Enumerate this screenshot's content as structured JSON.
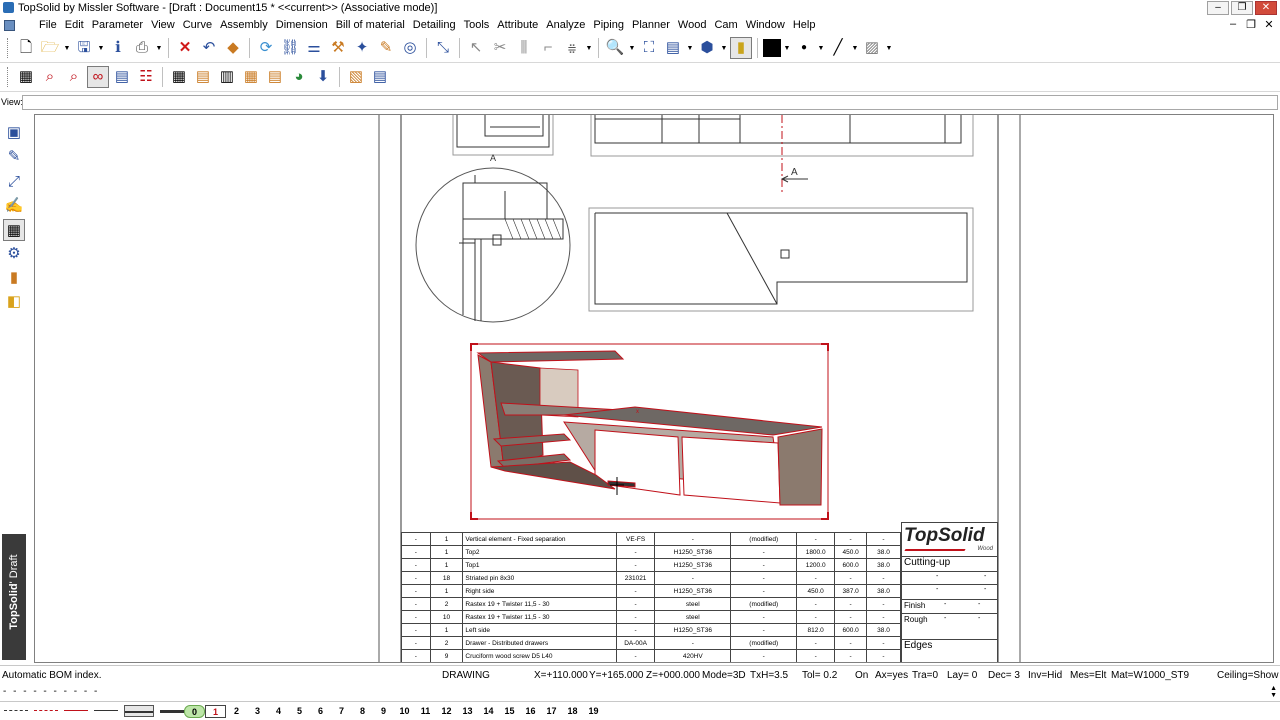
{
  "window": {
    "title": "TopSolid by Missler Software - [Draft : Document15 *  <<current>> (Associative mode)]",
    "buttons": {
      "minimize": "‒",
      "restore": "❐",
      "close": "✕"
    }
  },
  "menubar": {
    "items": [
      "File",
      "Edit",
      "Parameter",
      "View",
      "Curve",
      "Assembly",
      "Dimension",
      "Bill of material",
      "Detailing",
      "Tools",
      "Attribute",
      "Analyze",
      "Piping",
      "Planner",
      "Wood",
      "Cam",
      "Window",
      "Help"
    ],
    "mdi_buttons": {
      "minimize": "‒",
      "restore": "❐",
      "close": "✕"
    }
  },
  "viewbar": {
    "label": "View:",
    "value": ""
  },
  "sidebar": {
    "brand_main": "TopSolid",
    "brand_sub": "' Draft"
  },
  "drawing": {
    "section_label": "A",
    "arrow_label": "A",
    "accent_color": "#c0111a"
  },
  "bom": {
    "rows": [
      [
        "-",
        "1",
        "Vertical element - Fixed separation",
        "VE-FS",
        "-",
        "(modified)",
        "-",
        "-",
        "-"
      ],
      [
        "-",
        "1",
        "Top2",
        "-",
        "H1250_ST36",
        "-",
        "1800.0",
        "450.0",
        "38.0"
      ],
      [
        "-",
        "1",
        "Top1",
        "-",
        "H1250_ST36",
        "-",
        "1200.0",
        "600.0",
        "38.0"
      ],
      [
        "-",
        "18",
        "Striated pin 8x30",
        "231021",
        "-",
        "-",
        "-",
        "-",
        "-"
      ],
      [
        "-",
        "1",
        "Right side",
        "-",
        "H1250_ST36",
        "-",
        "450.0",
        "387.0",
        "38.0"
      ],
      [
        "-",
        "2",
        "Rastex 19 + Twister 11,5 - 30",
        "-",
        "steel",
        "(modified)",
        "-",
        "-",
        "-"
      ],
      [
        "-",
        "10",
        "Rastex 19 + Twister 11,5 - 30",
        "-",
        "steel",
        "-",
        "-",
        "-",
        "-"
      ],
      [
        "-",
        "1",
        "Left side",
        "-",
        "H1250_ST36",
        "-",
        "812.0",
        "600.0",
        "38.0"
      ],
      [
        "-",
        "2",
        "Drawer - Distributed drawers",
        "DA-00A",
        "-",
        "(modified)",
        "-",
        "-",
        "-"
      ],
      [
        "-",
        "9",
        "Cruciform wood screw D5 L40",
        "-",
        "420HV",
        "-",
        "-",
        "-",
        "-"
      ]
    ]
  },
  "titleblock": {
    "logo": "TopSolid",
    "logo_sub": "Wood",
    "cutting_up": "Cutting-up",
    "dash": "-",
    "finish": "Finish",
    "rough": "Rough",
    "edges": "Edges"
  },
  "status": {
    "message": "Automatic BOM index.",
    "mode": "DRAWING",
    "x": "X=+110.000",
    "y": "Y=+165.000",
    "z": "Z=+000.000",
    "mode3d": "Mode=3D",
    "txh": "TxH=3.5",
    "tol": "Tol=  0.2",
    "on": "On",
    "ax": "Ax=yes",
    "tra": "Tra=0",
    "lay": "Lay= 0",
    "dec": "Dec= 3",
    "inv": "Inv=Hid",
    "mes": "Mes=Elt",
    "mat": "Mat=W1000_ST9",
    "ceiling": "Ceiling=Show"
  },
  "cmdline": {
    "text": "- - - - - - - - - -"
  },
  "layerbar": {
    "current": "0",
    "selected": "1",
    "numbers": [
      "2",
      "3",
      "4",
      "5",
      "6",
      "7",
      "8",
      "9",
      "10",
      "11",
      "12",
      "13",
      "14",
      "15",
      "16",
      "17",
      "18",
      "19"
    ]
  }
}
